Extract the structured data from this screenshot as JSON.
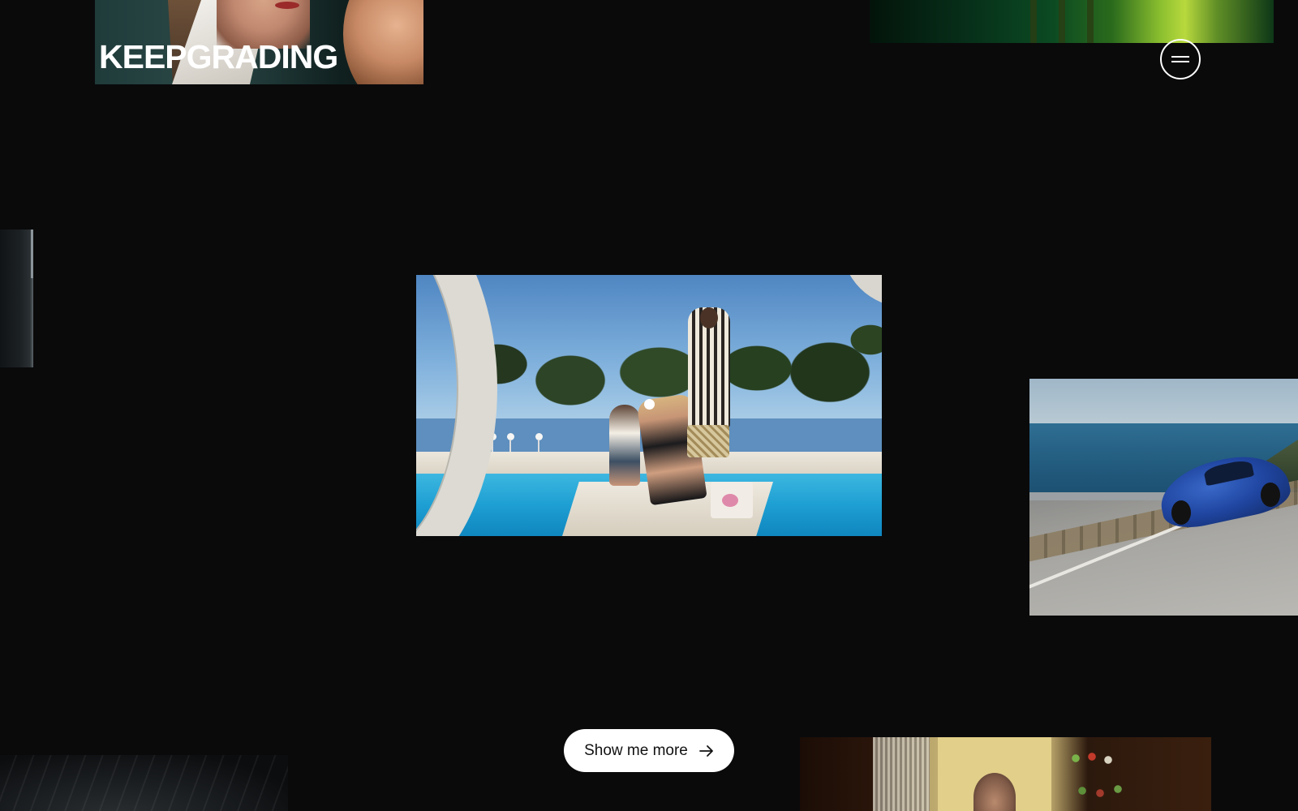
{
  "brand": {
    "logo_text": "KEEPGRADING"
  },
  "header": {
    "menu_icon": "hamburger-icon"
  },
  "gallery": {
    "items": [
      {
        "name": "portrait-tile"
      },
      {
        "name": "green-tile"
      },
      {
        "name": "left-edge-tile"
      },
      {
        "name": "pool-scene-tile"
      },
      {
        "name": "car-tile"
      },
      {
        "name": "dark-tile"
      },
      {
        "name": "interior-tile"
      }
    ]
  },
  "cta": {
    "label": "Show me more",
    "icon": "arrow-right-icon"
  },
  "colors": {
    "background": "#0a0a0b",
    "text": "#ffffff",
    "button_bg": "#ffffff",
    "button_text": "#111111"
  }
}
